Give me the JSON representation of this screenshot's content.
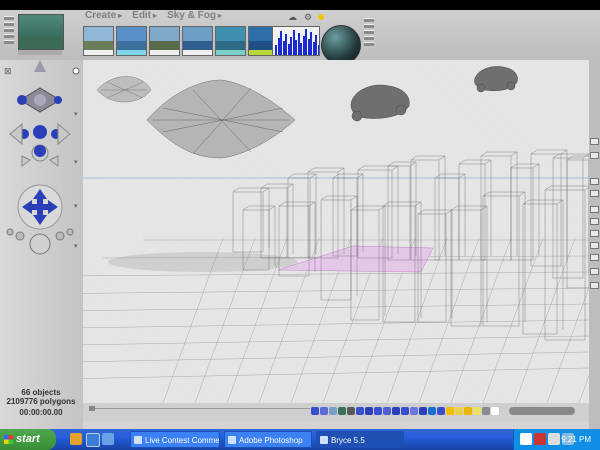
{
  "app": {
    "menus": [
      {
        "label": "Create",
        "active": false
      },
      {
        "label": "Edit",
        "active": false
      },
      {
        "label": "Sky & Fog",
        "active": true
      }
    ],
    "status": {
      "objects": "66 objects",
      "polygons": "2109776 polygons",
      "time": "00:00:00.00"
    }
  },
  "presets": [
    {
      "sky": "#8fb8d8",
      "land": "#6b7d5a",
      "label": "#f0f0f0"
    },
    {
      "sky": "#5a8fc8",
      "land": "#3e6f9e",
      "label": "#7fd6e8"
    },
    {
      "sky": "#7ea8c8",
      "land": "#5a6a4a",
      "label": "#f0f0f0"
    },
    {
      "sky": "#6d9ec4",
      "land": "#2f5f8f",
      "label": "#f0f0f0"
    },
    {
      "sky": "#3f8fb0",
      "land": "#2b6b86",
      "label": "#7ad0c8"
    },
    {
      "sky": "#2d6fa8",
      "land": "#1f4f86",
      "label": "#b8d83a"
    },
    {
      "sky": "#8ab4dc",
      "land": "#5a88b8",
      "label": "#f0f0f0"
    }
  ],
  "taskbar": {
    "start_label": "start",
    "tasks": [
      {
        "label": "Live Contest Commen...",
        "active": false
      },
      {
        "label": "Adobe Photoshop",
        "active": false
      },
      {
        "label": "Bryce 5.5",
        "active": true
      }
    ],
    "clock": "9:21 PM"
  }
}
